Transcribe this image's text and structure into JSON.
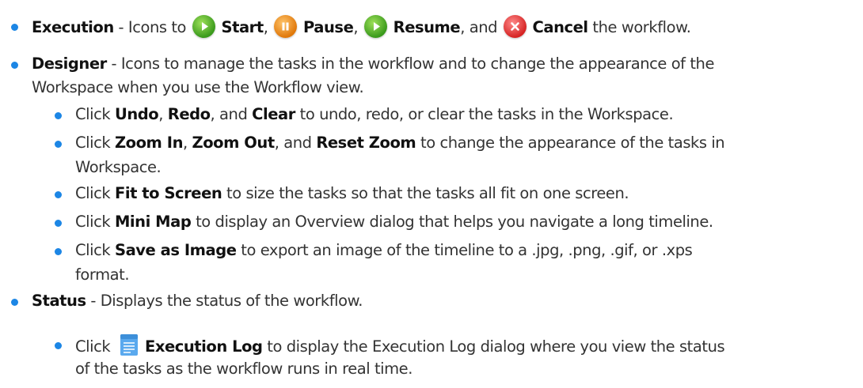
{
  "colors": {
    "bullet": "#1c86e5",
    "text": "#333333"
  },
  "execution": {
    "term": "Execution",
    "text1": " - Icons to ",
    "start": "Start",
    "sep1": ", ",
    "pause": "Pause",
    "sep2": ", ",
    "resume": "Resume",
    "text2": ", and ",
    "cancel": "Cancel",
    "text3": " the workflow."
  },
  "designer": {
    "term": "Designer",
    "text1": " - Icons to manage the tasks in the workflow and to change the appearance of the",
    "line2": "Workspace when you use the Workflow view.",
    "items": [
      {
        "pre": "Click ",
        "b1": "Undo",
        "m1": ", ",
        "b2": "Redo",
        "m2": ", and ",
        "b3": "Clear",
        "post": " to undo, redo, or clear the tasks in the Workspace."
      },
      {
        "pre": "Click ",
        "b1": "Zoom In",
        "m1": ", ",
        "b2": "Zoom Out",
        "m2": ", and ",
        "b3": "Reset Zoom",
        "post": " to change the appearance of the tasks in",
        "cont": "Workspace."
      },
      {
        "pre": "Click ",
        "b1": "Fit to Screen",
        "post": " to size the tasks so that the tasks all fit on one screen."
      },
      {
        "pre": "Click ",
        "b1": "Mini Map",
        "post": " to display an Overview dialog that helps you navigate a long timeline."
      },
      {
        "pre": "Click ",
        "b1": "Save as Image",
        "post": " to export an image of the timeline to a .jpg, .png, .gif, or .xps",
        "cont": "format."
      }
    ]
  },
  "status": {
    "term": "Status",
    "text1": " - Displays the status of the workflow.",
    "item": {
      "pre": "Click ",
      "b1": "Execution Log",
      "post": " to display the Execution Log dialog where you view the status",
      "cont": "of the tasks as the workflow runs in real time."
    }
  },
  "icons": {
    "start": "play-icon",
    "pause": "pause-icon",
    "resume": "resume-icon",
    "cancel": "cancel-icon",
    "log": "execution-log-icon"
  }
}
